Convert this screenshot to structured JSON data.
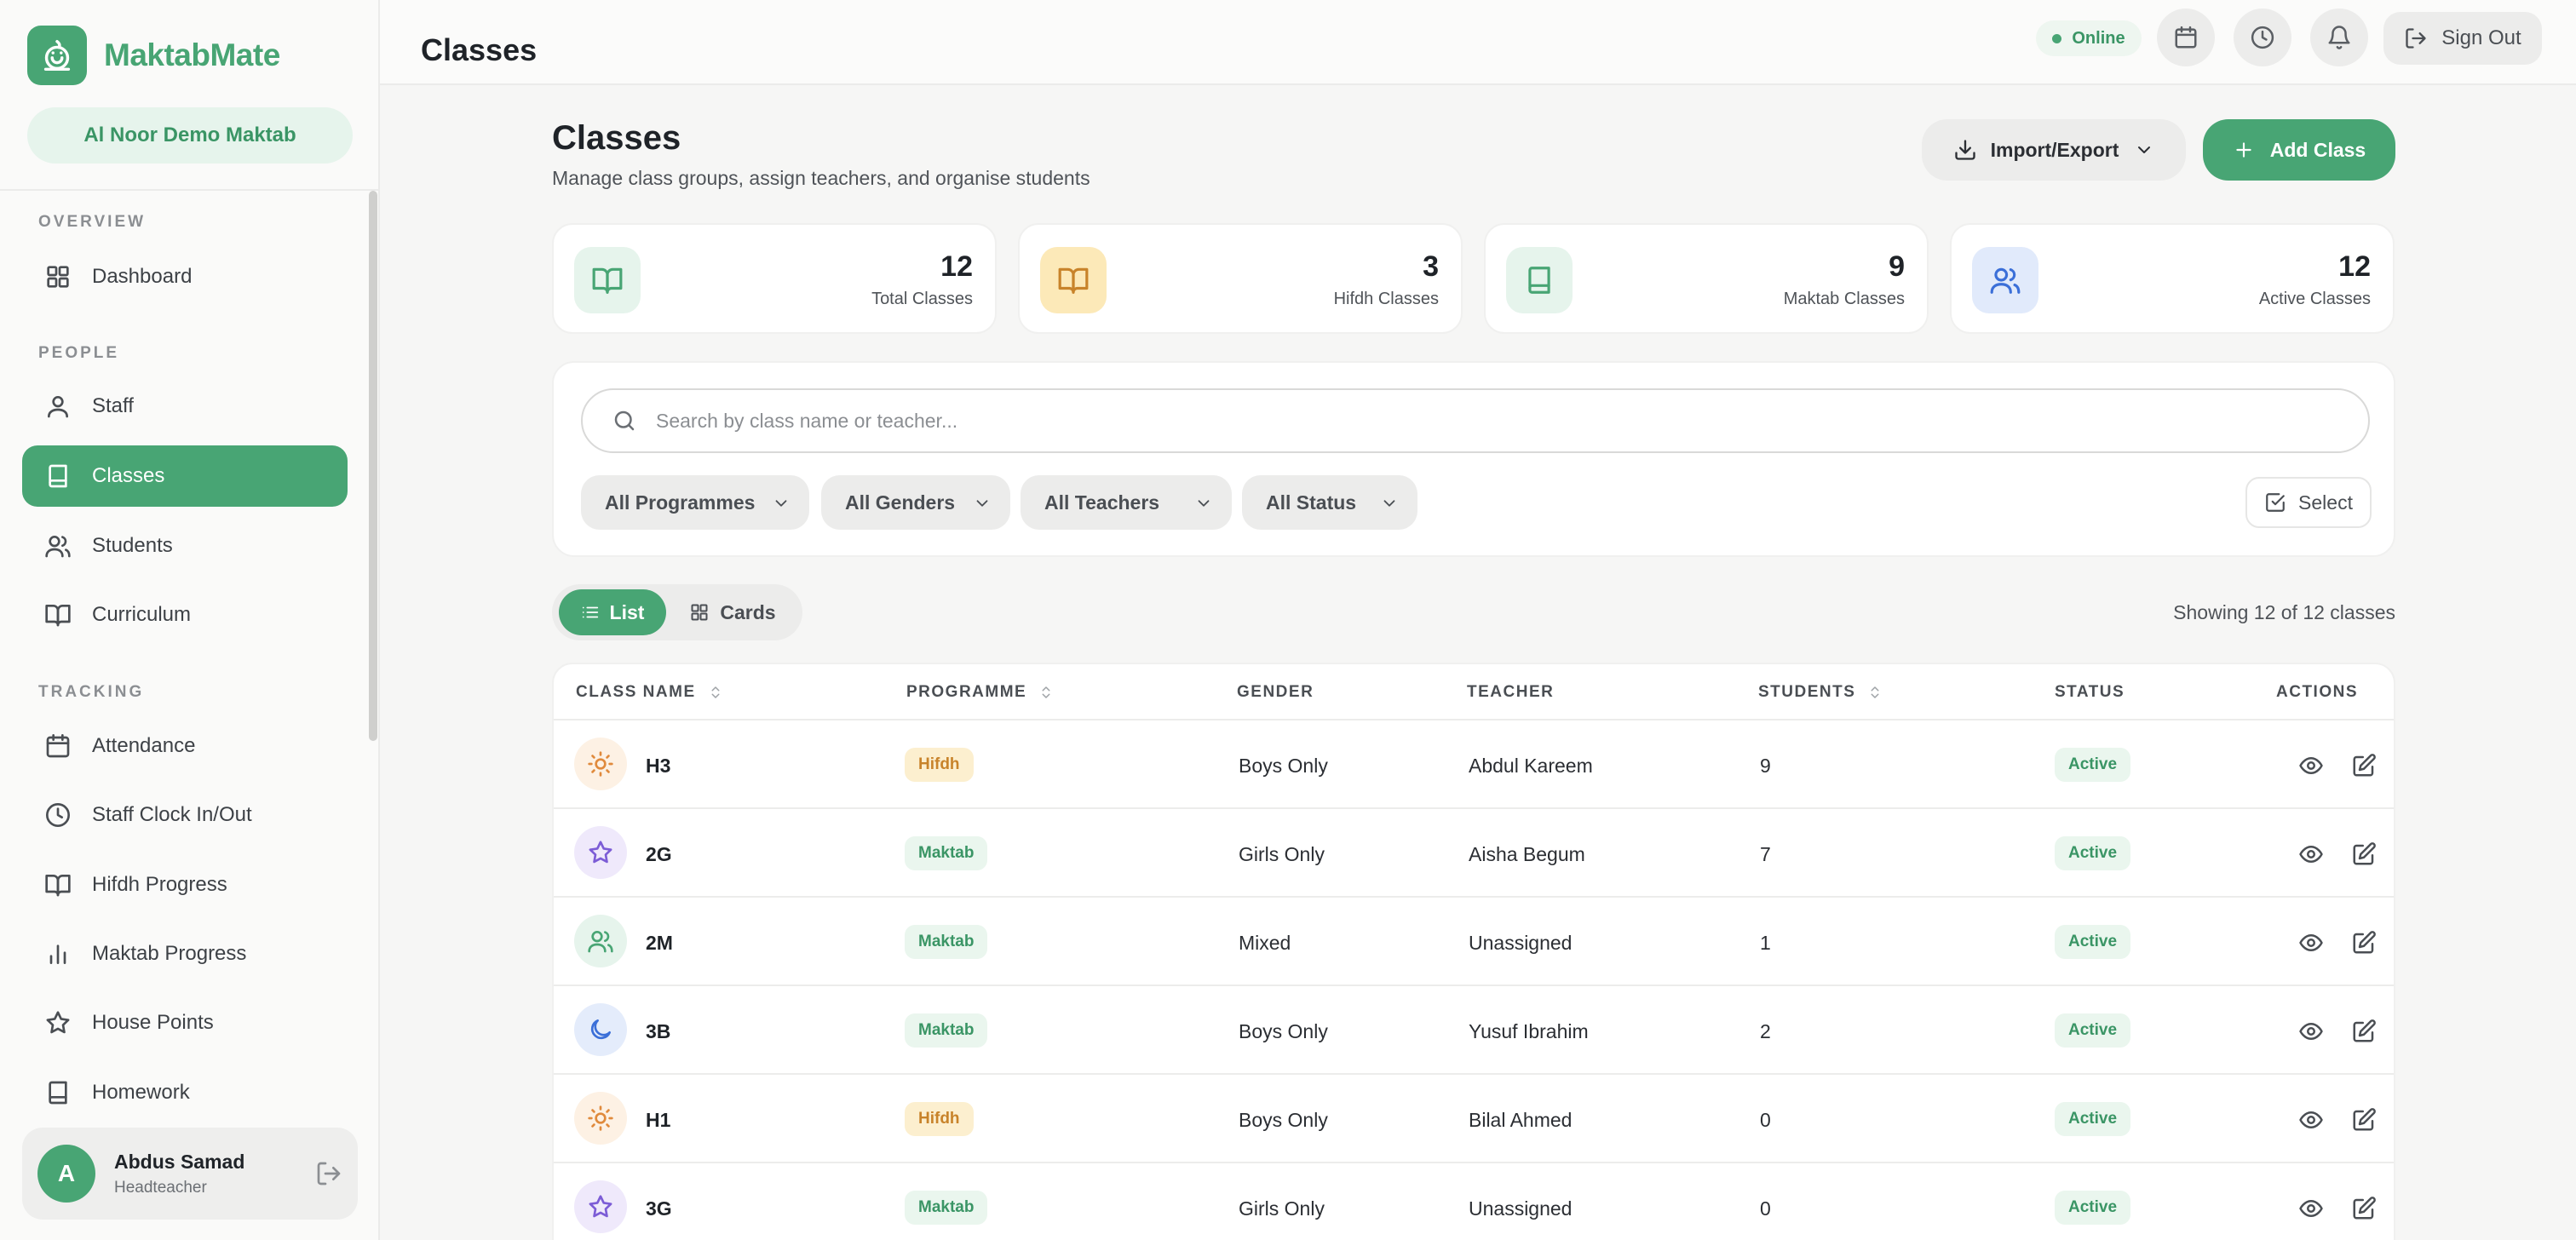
{
  "app": {
    "name": "MaktabMate",
    "org": "Al Noor Demo Maktab"
  },
  "sidebar": {
    "sections": [
      "OVERVIEW",
      "PEOPLE",
      "TRACKING"
    ],
    "items": [
      {
        "label": "Dashboard",
        "icon": "grid-icon"
      },
      {
        "label": "Staff",
        "icon": "user-icon"
      },
      {
        "label": "Classes",
        "icon": "book-icon",
        "active": true
      },
      {
        "label": "Students",
        "icon": "users-icon"
      },
      {
        "label": "Curriculum",
        "icon": "book-open-icon"
      },
      {
        "label": "Attendance",
        "icon": "calendar-icon"
      },
      {
        "label": "Staff Clock In/Out",
        "icon": "clock-icon"
      },
      {
        "label": "Hifdh Progress",
        "icon": "book-open-icon"
      },
      {
        "label": "Maktab Progress",
        "icon": "bar-chart-icon"
      },
      {
        "label": "House Points",
        "icon": "star-icon"
      },
      {
        "label": "Homework",
        "icon": "book-icon"
      }
    ]
  },
  "user": {
    "initial": "A",
    "name": "Abdus Samad",
    "role": "Headteacher"
  },
  "topbar": {
    "title": "Classes",
    "status": "Online",
    "sign_out": "Sign Out"
  },
  "header": {
    "title": "Classes",
    "subtitle": "Manage class groups, assign teachers, and organise students",
    "import_export": "Import/Export",
    "add_class": "Add Class"
  },
  "stats": [
    {
      "value": "12",
      "label": "Total Classes",
      "icon": "book-open-icon"
    },
    {
      "value": "3",
      "label": "Hifdh Classes",
      "icon": "book-open-icon"
    },
    {
      "value": "9",
      "label": "Maktab Classes",
      "icon": "book-icon"
    },
    {
      "value": "12",
      "label": "Active Classes",
      "icon": "users-icon"
    }
  ],
  "filters": {
    "search_placeholder": "Search by class name or teacher...",
    "programme": "All Programmes",
    "gender": "All Genders",
    "teacher": "All Teachers",
    "status": "All Status",
    "select": "Select"
  },
  "view": {
    "list": "List",
    "cards": "Cards",
    "showing": "Showing 12 of 12 classes"
  },
  "table": {
    "columns": [
      "CLASS NAME",
      "PROGRAMME",
      "GENDER",
      "TEACHER",
      "STUDENTS",
      "STATUS",
      "ACTIONS"
    ],
    "rows": [
      {
        "name": "H3",
        "icon": "sun-icon",
        "programme": "Hifdh",
        "gender": "Boys Only",
        "teacher": "Abdul Kareem",
        "students": "9",
        "status": "Active"
      },
      {
        "name": "2G",
        "icon": "star-icon",
        "programme": "Maktab",
        "gender": "Girls Only",
        "teacher": "Aisha Begum",
        "students": "7",
        "status": "Active"
      },
      {
        "name": "2M",
        "icon": "users-icon",
        "programme": "Maktab",
        "gender": "Mixed",
        "teacher": "Unassigned",
        "students": "1",
        "status": "Active"
      },
      {
        "name": "3B",
        "icon": "moon-icon",
        "programme": "Maktab",
        "gender": "Boys Only",
        "teacher": "Yusuf Ibrahim",
        "students": "2",
        "status": "Active"
      },
      {
        "name": "H1",
        "icon": "sun-icon",
        "programme": "Hifdh",
        "gender": "Boys Only",
        "teacher": "Bilal Ahmed",
        "students": "0",
        "status": "Active"
      },
      {
        "name": "3G",
        "icon": "star-icon",
        "programme": "Maktab",
        "gender": "Girls Only",
        "teacher": "Unassigned",
        "students": "0",
        "status": "Active"
      }
    ]
  },
  "colors": {
    "brand": "#48a574",
    "hifdh_bg": "#fcefcf",
    "hifdh_text": "#c8832a",
    "maktab_bg": "#eaf6ee",
    "maktab_text": "#3a9565"
  }
}
